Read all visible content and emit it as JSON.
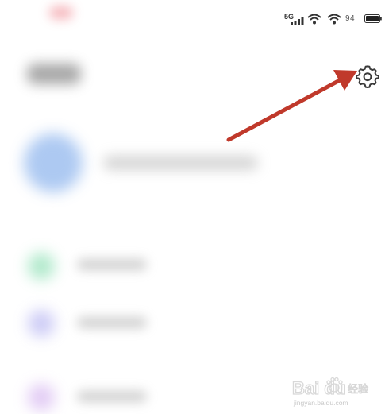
{
  "status_bar": {
    "network": "5G",
    "battery_percent": "94"
  },
  "settings": {
    "icon": "gear-icon"
  },
  "annotation": {
    "color": "#c0392b"
  },
  "watermark": {
    "brand": "Bai du",
    "subtitle": "jingyan.baidu.com"
  }
}
